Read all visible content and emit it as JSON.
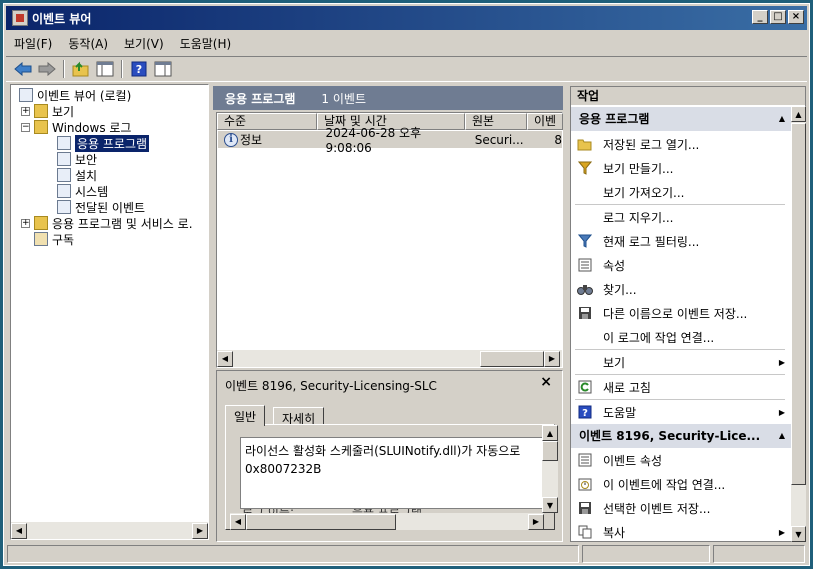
{
  "window": {
    "title": "이벤트 뷰어"
  },
  "menu": [
    "파일(F)",
    "동작(A)",
    "보기(V)",
    "도움말(H)"
  ],
  "tree": {
    "root": "이벤트 뷰어 (로컬)",
    "items": [
      {
        "label": "보기",
        "icon": "folder-icon",
        "expander": "+"
      },
      {
        "label": "Windows 로그",
        "icon": "folder-icon",
        "expander": "-"
      },
      {
        "label": "응용 프로그램",
        "icon": "log-icon",
        "selected": true
      },
      {
        "label": "보안",
        "icon": "log-icon"
      },
      {
        "label": "설치",
        "icon": "log-icon"
      },
      {
        "label": "시스템",
        "icon": "log-icon"
      },
      {
        "label": "전달된 이벤트",
        "icon": "log-icon"
      },
      {
        "label": "응용 프로그램 및 서비스 로.",
        "icon": "folder-icon",
        "expander": "+"
      },
      {
        "label": "구독",
        "icon": "subscription-icon"
      }
    ]
  },
  "center": {
    "title": "응용 프로그램",
    "count": "1 이벤트",
    "columns": [
      "수준",
      "날짜 및 시간",
      "원본",
      "이벤"
    ],
    "rows": [
      {
        "level": "정보",
        "datetime": "2024-06-28 오후 9:08:06",
        "source": "Securi...",
        "id": "8"
      }
    ]
  },
  "detail": {
    "title": "이벤트 8196, Security-Licensing-SLC",
    "close": "×",
    "tabs": [
      "일반",
      "자세히"
    ],
    "description_line1": "라이선스 활성화 스케줄러(SLUINotify.dll)가 자동으로",
    "description_line2": "0x8007232B",
    "field_label": "로그 이름:",
    "field_value": "응용 프로그램"
  },
  "actions": {
    "header": "작업",
    "section1": "응용 프로그램",
    "items1": [
      {
        "label": "저장된 로그 열기...",
        "icon": "open-folder-icon"
      },
      {
        "label": "보기 만들기...",
        "icon": "filter-icon"
      },
      {
        "label": "보기 가져오기...",
        "icon": ""
      },
      {
        "label": "로그 지우기...",
        "icon": ""
      },
      {
        "label": "현재 로그 필터링...",
        "icon": "filter-icon"
      },
      {
        "label": "속성",
        "icon": "properties-icon"
      },
      {
        "label": "찾기...",
        "icon": "binoculars-icon"
      },
      {
        "label": "다른 이름으로 이벤트 저장...",
        "icon": "save-icon"
      },
      {
        "label": "이 로그에 작업 연결...",
        "icon": ""
      },
      {
        "label": "보기",
        "icon": "",
        "submenu": true
      },
      {
        "label": "새로 고침",
        "icon": "refresh-icon"
      },
      {
        "label": "도움말",
        "icon": "help-icon",
        "submenu": true
      }
    ],
    "section2": "이벤트 8196, Security-Lice...",
    "items2": [
      {
        "label": "이벤트 속성",
        "icon": "properties-icon"
      },
      {
        "label": "이 이벤트에 작업 연결...",
        "icon": "task-icon"
      },
      {
        "label": "선택한 이벤트 저장...",
        "icon": "save-icon"
      },
      {
        "label": "복사",
        "icon": "copy-icon",
        "submenu": true
      }
    ]
  }
}
